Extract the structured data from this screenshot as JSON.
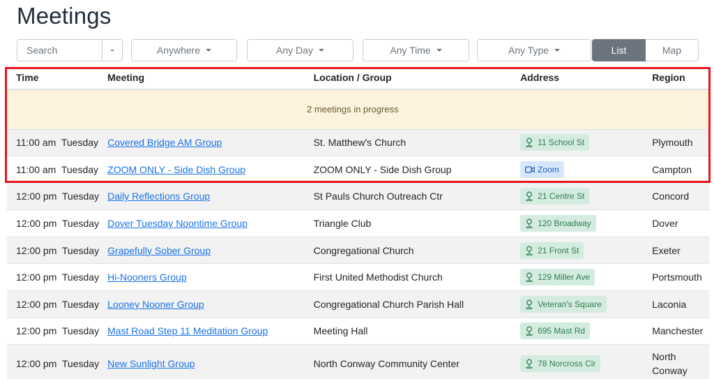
{
  "page": {
    "title": "Meetings"
  },
  "filters": {
    "search_placeholder": "Search",
    "region_label": "Anywhere",
    "day_label": "Any Day",
    "time_label": "Any Time",
    "type_label": "Any Type",
    "view_list": "List",
    "view_map": "Map"
  },
  "table": {
    "headers": {
      "time": "Time",
      "meeting": "Meeting",
      "location": "Location / Group",
      "address": "Address",
      "region": "Region"
    },
    "in_progress_text": "2 meetings in progress",
    "rows": [
      {
        "time": "11:00 am  Tuesday",
        "meeting": "Covered Bridge AM Group",
        "location": "St. Matthew's Church",
        "address": "11 School St",
        "address_type": "pin",
        "region": "Plymouth"
      },
      {
        "time": "11:00 am  Tuesday",
        "meeting": "ZOOM ONLY - Side Dish Group",
        "location": "ZOOM ONLY - Side Dish Group",
        "address": "Zoom",
        "address_type": "zoom",
        "region": "Campton"
      },
      {
        "time": "12:00 pm  Tuesday",
        "meeting": "Daily Reflections Group",
        "location": "St Pauls Church Outreach Ctr",
        "address": "21 Centre St",
        "address_type": "pin",
        "region": "Concord"
      },
      {
        "time": "12:00 pm  Tuesday",
        "meeting": "Dover Tuesday Noontime Group",
        "location": "Triangle Club",
        "address": "120 Broadway",
        "address_type": "pin",
        "region": "Dover"
      },
      {
        "time": "12:00 pm  Tuesday",
        "meeting": "Grapefully Sober Group",
        "location": "Congregational Church",
        "address": "21 Front St",
        "address_type": "pin",
        "region": "Exeter"
      },
      {
        "time": "12:00 pm  Tuesday",
        "meeting": "Hi-Nooners Group",
        "location": "First United Methodist Church",
        "address": "129 Miller Ave",
        "address_type": "pin",
        "region": "Portsmouth"
      },
      {
        "time": "12:00 pm  Tuesday",
        "meeting": "Looney Nooner Group",
        "location": "Congregational Church Parish Hall",
        "address": "Veteran's Square",
        "address_type": "pin",
        "region": "Laconia"
      },
      {
        "time": "12:00 pm  Tuesday",
        "meeting": "Mast Road Step 11 Meditation Group",
        "location": "Meeting Hall",
        "address": "695 Mast Rd",
        "address_type": "pin",
        "region": "Manchester"
      },
      {
        "time": "12:00 pm  Tuesday",
        "meeting": "New Sunlight Group",
        "location": "North Conway Community Center",
        "address": "78 Norcross Cir",
        "address_type": "pin",
        "region": "North Conway"
      }
    ]
  },
  "colors": {
    "highlight": "#e8141c",
    "link": "#1a73e8",
    "in_progress_bg": "#fcf3dd"
  }
}
